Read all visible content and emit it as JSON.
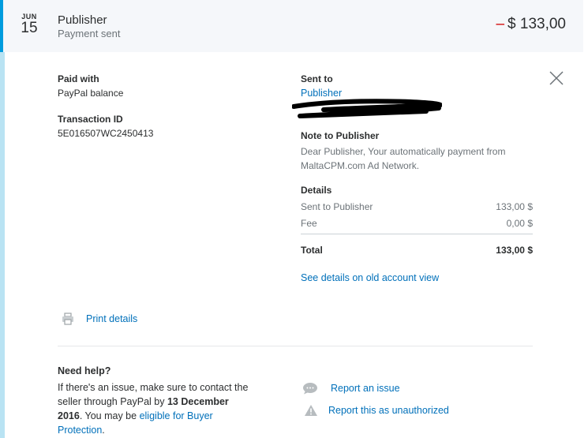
{
  "transaction": {
    "month": "JUN",
    "day": "15",
    "name": "Publisher",
    "status": "Payment sent",
    "amount_sign": "–",
    "amount": "$ 133,00"
  },
  "left": {
    "paid_with_label": "Paid with",
    "paid_with_value": "PayPal balance",
    "transaction_id_label": "Transaction ID",
    "transaction_id_value": "5E016507WC2450413",
    "print_label": "Print details"
  },
  "right": {
    "sent_to_label": "Sent to",
    "sent_to_value": "Publisher",
    "note_label": "Note to Publisher",
    "note_text": "Dear Publisher, Your automatically payment from MaltaCPM.com Ad Network.",
    "details_label": "Details",
    "rows": [
      {
        "label": "Sent to Publisher",
        "value": "133,00 $"
      },
      {
        "label": "Fee",
        "value": "0,00 $"
      }
    ],
    "total_label": "Total",
    "total_value": "133,00 $",
    "old_view_link": "See details on old account view"
  },
  "help": {
    "title": "Need help?",
    "text_1": "If there's an issue, make sure to contact the seller through PayPal by ",
    "deadline": "13 December 2016",
    "text_2": ". You may be ",
    "protection_link": "eligible for Buyer Protection",
    "text_3": ".",
    "report_issue": "Report an issue",
    "report_unauthorized": "Report this as unauthorized"
  },
  "colors": {
    "accent": "#009cde",
    "link": "#0070ba",
    "negative": "#d20000"
  },
  "icons": {
    "close": "close-icon",
    "print": "printer-icon",
    "chat": "chat-bubble-icon",
    "warning": "warning-icon"
  }
}
